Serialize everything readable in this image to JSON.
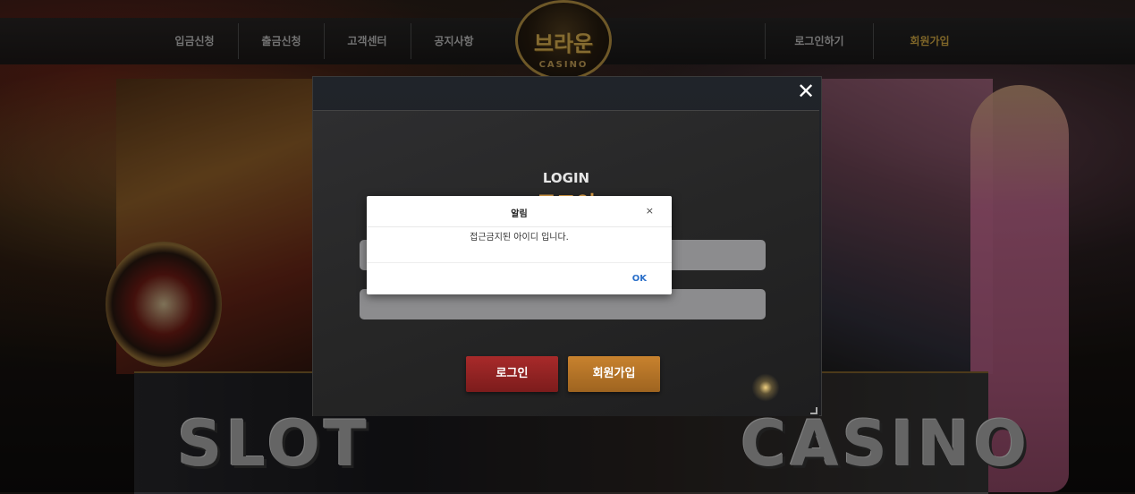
{
  "nav": {
    "deposit": "입금신청",
    "withdraw": "출금신청",
    "support": "고객센터",
    "notice": "공지사항",
    "login": "로그인하기",
    "signup": "회원가입"
  },
  "logo": {
    "text": "브라운",
    "sub": "CASINO"
  },
  "banners": {
    "slot": "SLOT",
    "casino": "CASINO"
  },
  "login_modal": {
    "close_glyph": "✕",
    "title_en": "LOGIN",
    "title_ko": "로그인",
    "login_button": "로그인",
    "join_button": "회원가입"
  },
  "alert": {
    "title": "알림",
    "close_glyph": "×",
    "message": "접근금지된 아이디 입니다.",
    "ok_label": "OK"
  },
  "colors": {
    "accent_gold": "#e6b84a",
    "login_button": "#a82a2a",
    "join_button": "#c8822e",
    "ok_link": "#2a6fc9"
  }
}
